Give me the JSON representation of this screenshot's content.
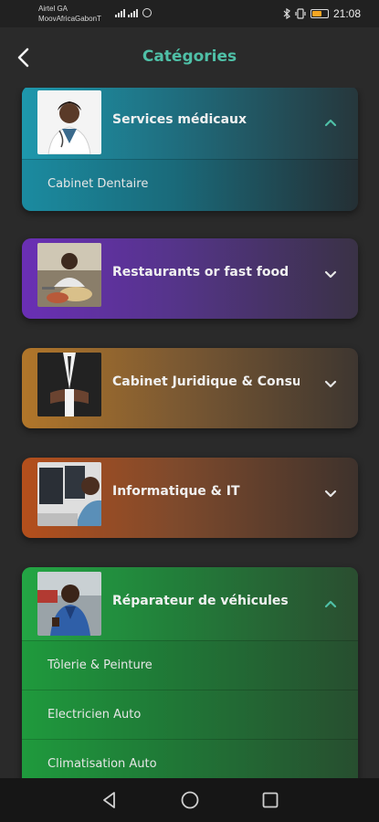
{
  "status": {
    "carrier_line1": "Airtel GA",
    "carrier_line2": "MoovAfricaGabonT",
    "time": "21:08",
    "battery_percent": 60
  },
  "header": {
    "title": "Catégories",
    "back_icon": "chevron-left-icon"
  },
  "categories": [
    {
      "label": "Services médicaux",
      "expanded": true,
      "color": "#1b8ba0",
      "subitems": [
        "Cabinet Dentaire"
      ]
    },
    {
      "label": "Restaurants or fast food",
      "expanded": false,
      "color": "#6a2fb5",
      "subitems": []
    },
    {
      "label": "Cabinet Juridique & Consulting",
      "expanded": false,
      "color": "#b1762a",
      "subitems": []
    },
    {
      "label": "Informatique & IT",
      "expanded": false,
      "color": "#b44f1c",
      "subitems": []
    },
    {
      "label": "Réparateur de véhicules",
      "expanded": true,
      "color": "#1f9a3d",
      "subitems": [
        "Tôlerie & Peinture",
        "Electricien Auto",
        "Climatisation Auto"
      ]
    }
  ],
  "navbar": {
    "back_icon": "triangle-back-icon",
    "home_icon": "circle-home-icon",
    "recents_icon": "square-recents-icon"
  },
  "accent_color": "#4fc0a7"
}
